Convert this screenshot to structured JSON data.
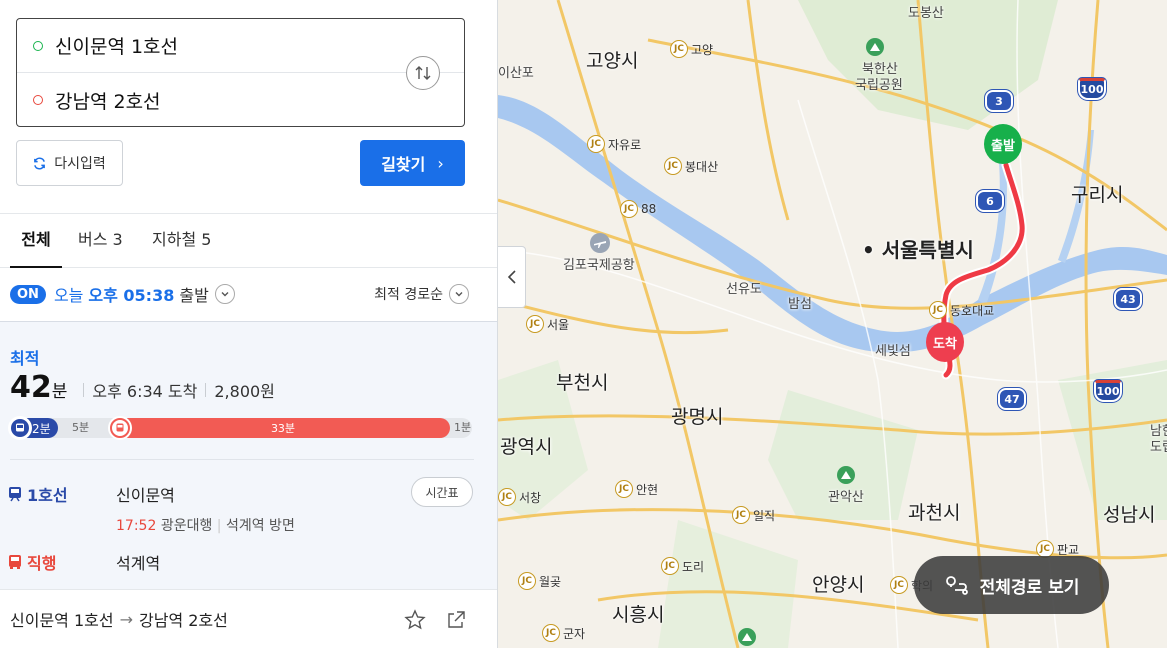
{
  "search": {
    "origin": "신이문역 1호선",
    "destination": "강남역 2호선",
    "reset_label": "다시입력",
    "find_label": "길찾기"
  },
  "tabs": [
    {
      "label": "전체"
    },
    {
      "label": "버스 3"
    },
    {
      "label": "지하철 5"
    }
  ],
  "departure": {
    "on_badge": "ON",
    "today": "오늘",
    "time": "오후 05:38",
    "suffix": "출발",
    "sort_label": "최적 경로순"
  },
  "result": {
    "tag": "최적",
    "minutes": "42",
    "minutes_unit": "분",
    "arrival": "오후 6:34 도착",
    "fare": "2,800원",
    "segments": {
      "bus": "2분",
      "walk1": "5분",
      "train": "33분",
      "walk2": "1분"
    },
    "steps": [
      {
        "line": "1호선",
        "station": "신이문역",
        "time": "17:52",
        "direction": "광운대행",
        "toward": "석계역 방면",
        "timetable": "시간표"
      },
      {
        "line": "직행",
        "station": "석계역"
      }
    ]
  },
  "footer": {
    "from": "신이문역 1호선",
    "arrow": "→",
    "to": "강남역 2호선"
  },
  "map": {
    "labels": {
      "dobong": "도봉산",
      "goyang_si": "고양시",
      "bukhansan": "북한산",
      "national_park": "국립공원",
      "isanpo": "이산포",
      "guri": "구리시",
      "gimpo_airport": "김포국제공항",
      "seoul": "서울특별시",
      "seonyudo": "선유도",
      "bamseom": "밤섬",
      "saebitseom": "세빛섬",
      "bucheon": "부천시",
      "gwangmyeong": "광명시",
      "gwangyeok": "광역시",
      "gwanaksan": "관악산",
      "gwacheon": "과천시",
      "seongnam": "성남시",
      "anyang": "안양시",
      "siheung": "시흥시",
      "namhan": "남한",
      "namhan2": "도립"
    },
    "jcs": {
      "goyang": "고양",
      "jayuro": "자유로",
      "bongdaesan": "봉대산",
      "n88": "88",
      "seoul_jc": "서울",
      "dongho": "동호대교",
      "seocheo": "서창",
      "anhyeon": "안현",
      "iljik": "일직",
      "dori": "도리",
      "wolgot": "월곶",
      "hakui": "학의",
      "pangyo": "판교",
      "gunja": "군자"
    },
    "shields": {
      "s3": "3",
      "s6": "6",
      "s100a": "100",
      "s43": "43",
      "s100b": "100",
      "s47": "47"
    },
    "start_pin": "출발",
    "end_pin": "도착",
    "full_route_label": "전체경로 보기"
  }
}
